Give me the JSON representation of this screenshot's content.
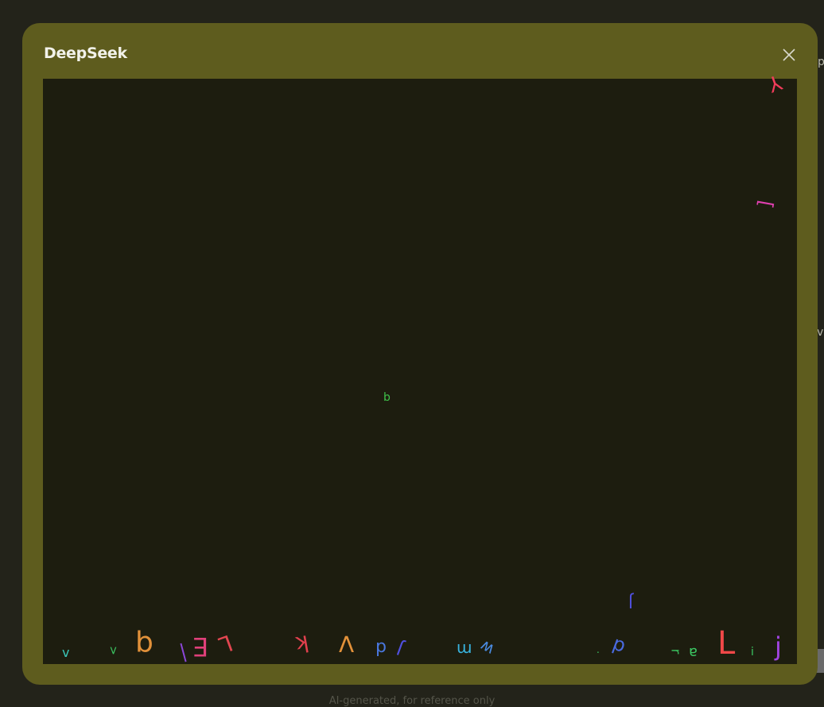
{
  "modal": {
    "title": "DeepSeek",
    "close_icon": "close-icon"
  },
  "canvas": {
    "glyphs": [
      {
        "char": "b",
        "color": "#3fc24a"
      },
      {
        "char": "v",
        "color": "#3ac6b8"
      },
      {
        "char": ">",
        "color": "#3cc863"
      },
      {
        "char": "q",
        "color": "#e2913a"
      },
      {
        "char": "|",
        "color": "#8b46d8"
      },
      {
        "char": "E",
        "color": "#e0407a"
      },
      {
        "char": "L",
        "color": "#e24650"
      },
      {
        "char": "k",
        "color": "#e2404e"
      },
      {
        "char": "V",
        "color": "#e2913a"
      },
      {
        "char": "d",
        "color": "#4a78e0"
      },
      {
        "char": "J",
        "color": "#5050e0"
      },
      {
        "char": "m",
        "color": "#38b4e0"
      },
      {
        "char": "w",
        "color": "#4a8ae0"
      },
      {
        "char": ".",
        "color": "#3cc863"
      },
      {
        "char": "d",
        "color": "#4a6ae0"
      },
      {
        "char": "J",
        "color": "#5050e0"
      },
      {
        "char": "r",
        "color": "#3cc863"
      },
      {
        "char": "a",
        "color": "#3cc863"
      },
      {
        "char": "L",
        "color": "#f04848"
      },
      {
        "char": "i",
        "color": "#3cc863"
      },
      {
        "char": "j",
        "color": "#a044e0"
      },
      {
        "char": "Y",
        "color": "#f03c5a"
      },
      {
        "char": "[",
        "color": "#e040b0"
      }
    ]
  },
  "background": {
    "right_edge_p": "p",
    "right_edge_v": "v"
  },
  "footer": {
    "text": "AI-generated, for reference only"
  }
}
